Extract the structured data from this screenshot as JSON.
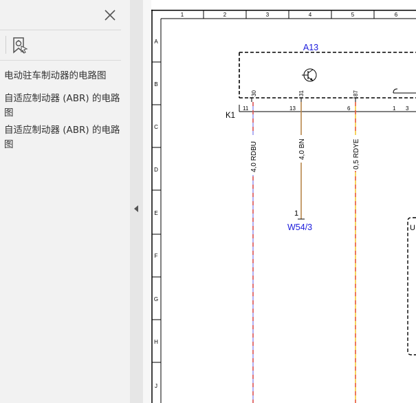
{
  "sidebar": {
    "close_label": "✕",
    "bookmarks": [
      {
        "label": "电动驻车制动器的电路图"
      },
      {
        "label": "自适应制动器 (ABR) 的电路图"
      },
      {
        "label": "自适应制动器 (ABR) 的电路图"
      }
    ]
  },
  "diagram": {
    "columns": [
      "1",
      "2",
      "3",
      "4",
      "5",
      "6"
    ],
    "rows": [
      "A",
      "B",
      "C",
      "D",
      "E",
      "F",
      "G",
      "H",
      "J"
    ],
    "component_a13": "A13",
    "component_k1": "K1",
    "component_w54": "W54/3",
    "component_u": "U",
    "pins_top": [
      "30",
      "31",
      "87"
    ],
    "pins_bottom": [
      "11",
      "13",
      "6",
      "1",
      "3"
    ],
    "pin_w54": "1",
    "wires": [
      "4,0 RDBU",
      "4,0 BN",
      "0,5 RDYE"
    ]
  },
  "colors": {
    "link_blue": "#1a1adc",
    "wire_red": "#e74a3c",
    "wire_blue": "#8f8ff0",
    "wire_brown": "#b8864a",
    "wire_yellow": "#f2c21b"
  }
}
